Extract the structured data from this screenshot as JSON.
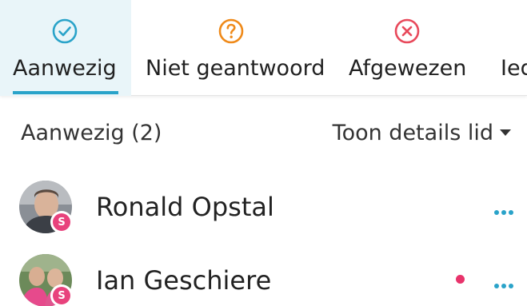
{
  "tabs": [
    {
      "label": "Aanwezig",
      "icon": "check-circle-icon",
      "color": "#2aa3c9",
      "active": true
    },
    {
      "label": "Niet geantwoord",
      "icon": "question-circle-icon",
      "color": "#ef8a1a",
      "active": false
    },
    {
      "label": "Afgewezen",
      "icon": "x-circle-icon",
      "color": "#e8495b",
      "active": false
    },
    {
      "label": "Iedereen",
      "active": false
    }
  ],
  "section": {
    "title": "Aanwezig (2)",
    "details_toggle": "Toon details lid"
  },
  "members": [
    {
      "name": "Ronald Opstal",
      "badge": "S",
      "unread": false
    },
    {
      "name": "Ian Geschiere",
      "badge": "S",
      "unread": true
    }
  ],
  "colors": {
    "accent": "#2aa3c9",
    "badge": "#e8427c",
    "unread": "#e8336b"
  }
}
